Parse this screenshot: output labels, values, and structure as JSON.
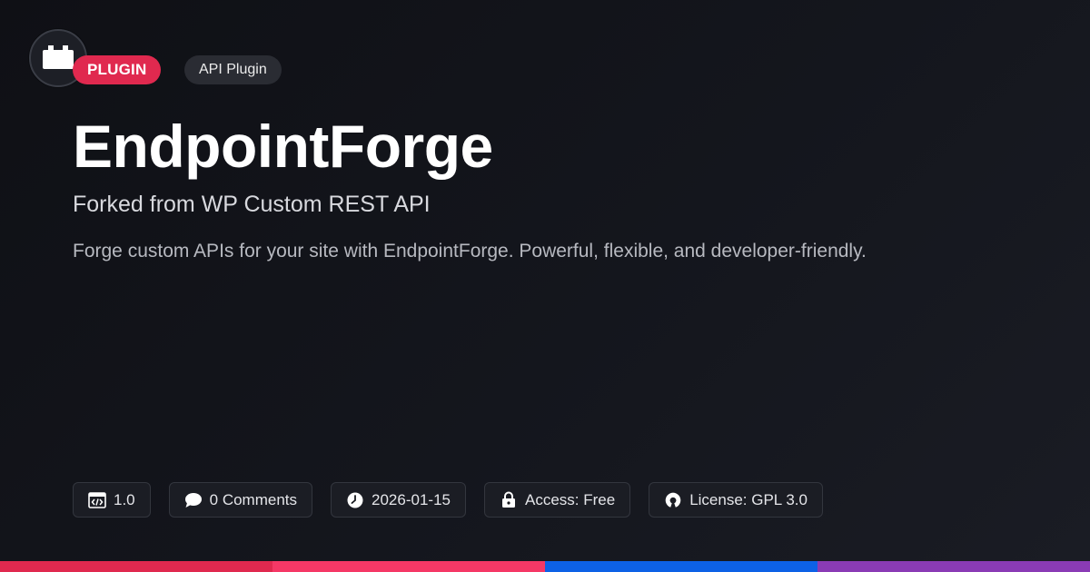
{
  "badges": {
    "type_label": "PLUGIN",
    "category_label": "API Plugin"
  },
  "title": "EndpointForge",
  "subtitle": "Forked from WP Custom REST API",
  "description": "Forge custom APIs for your site with EndpointForge. Powerful, flexible, and developer-friendly.",
  "meta": {
    "version": "1.0",
    "comments": "0 Comments",
    "date": "2026-01-15",
    "access": "Access: Free",
    "license": "License: GPL 3.0"
  },
  "icons": {
    "logo": "plugin-block-icon",
    "version": "code-window-icon",
    "comments": "speech-bubble-icon",
    "date": "clock-icon",
    "access": "lock-icon",
    "license": "open-source-icon"
  },
  "colors": {
    "accent": "#e0294f",
    "background": "#121318",
    "bar_colors": [
      "#e0294f",
      "#f53866",
      "#0d61e6",
      "#8a3bb5"
    ]
  }
}
